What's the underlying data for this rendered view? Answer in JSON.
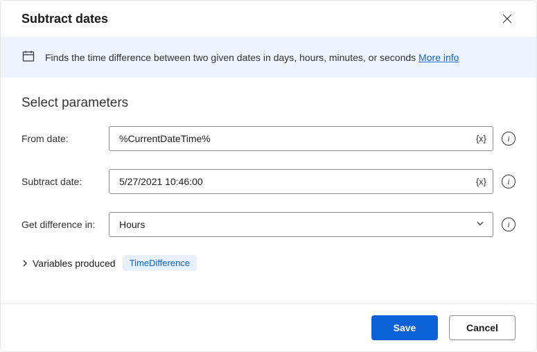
{
  "dialog": {
    "title": "Subtract dates",
    "info_text": "Finds the time difference between two given dates in days, hours, minutes, or seconds ",
    "more_info": "More info"
  },
  "section_title": "Select parameters",
  "fields": {
    "from_date": {
      "label": "From date:",
      "value": "%CurrentDateTime%",
      "var_token": "{x}"
    },
    "subtract_date": {
      "label": "Subtract date:",
      "value": "5/27/2021 10:46:00",
      "var_token": "{x}"
    },
    "get_difference": {
      "label": "Get difference in:",
      "value": "Hours"
    }
  },
  "variables": {
    "label": "Variables produced",
    "chip": "TimeDifference"
  },
  "buttons": {
    "save": "Save",
    "cancel": "Cancel"
  },
  "info_glyph": "i"
}
